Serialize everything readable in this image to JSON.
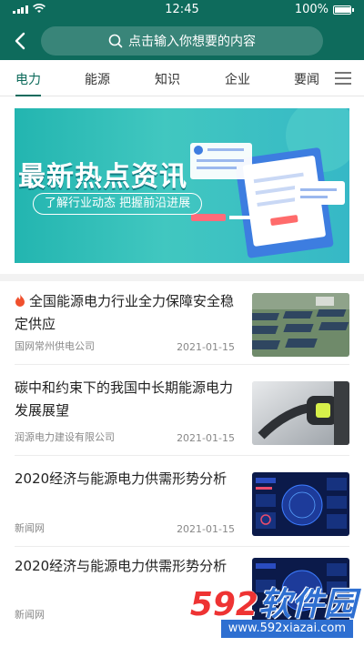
{
  "status_bar": {
    "time": "12:45",
    "battery": "100%",
    "battery_level": 1.0
  },
  "search": {
    "placeholder": "点击输入你想要的内容"
  },
  "tabs": [
    {
      "label": "电力",
      "active": true
    },
    {
      "label": "能源",
      "active": false
    },
    {
      "label": "知识",
      "active": false
    },
    {
      "label": "企业",
      "active": false
    },
    {
      "label": "要闻",
      "active": false
    }
  ],
  "banner": {
    "title": "最新热点资讯",
    "subtitle": "了解行业动态 把握前沿进展"
  },
  "news": [
    {
      "title": "全国能源电力行业全力保障安全稳定供应",
      "source": "国网常州供电公司",
      "date": "2021-01-15",
      "hot": true
    },
    {
      "title": "碳中和约束下的我国中长期能源电力发展展望",
      "source": "润源电力建设有限公司",
      "date": "2021-01-15",
      "hot": false
    },
    {
      "title": "2020经济与能源电力供需形势分析",
      "source": "新闻网",
      "date": "2021-01-15",
      "hot": false
    },
    {
      "title": "2020经济与能源电力供需形势分析",
      "source": "新闻网",
      "date": "",
      "hot": false
    }
  ],
  "watermark": {
    "brand_num": "592",
    "brand_cn": "软件园",
    "url": "www.592xiazai.com"
  },
  "colors": {
    "primary": "#0e6b5c",
    "banner": "#36b8c6",
    "watermark": "#2e6fd1"
  }
}
